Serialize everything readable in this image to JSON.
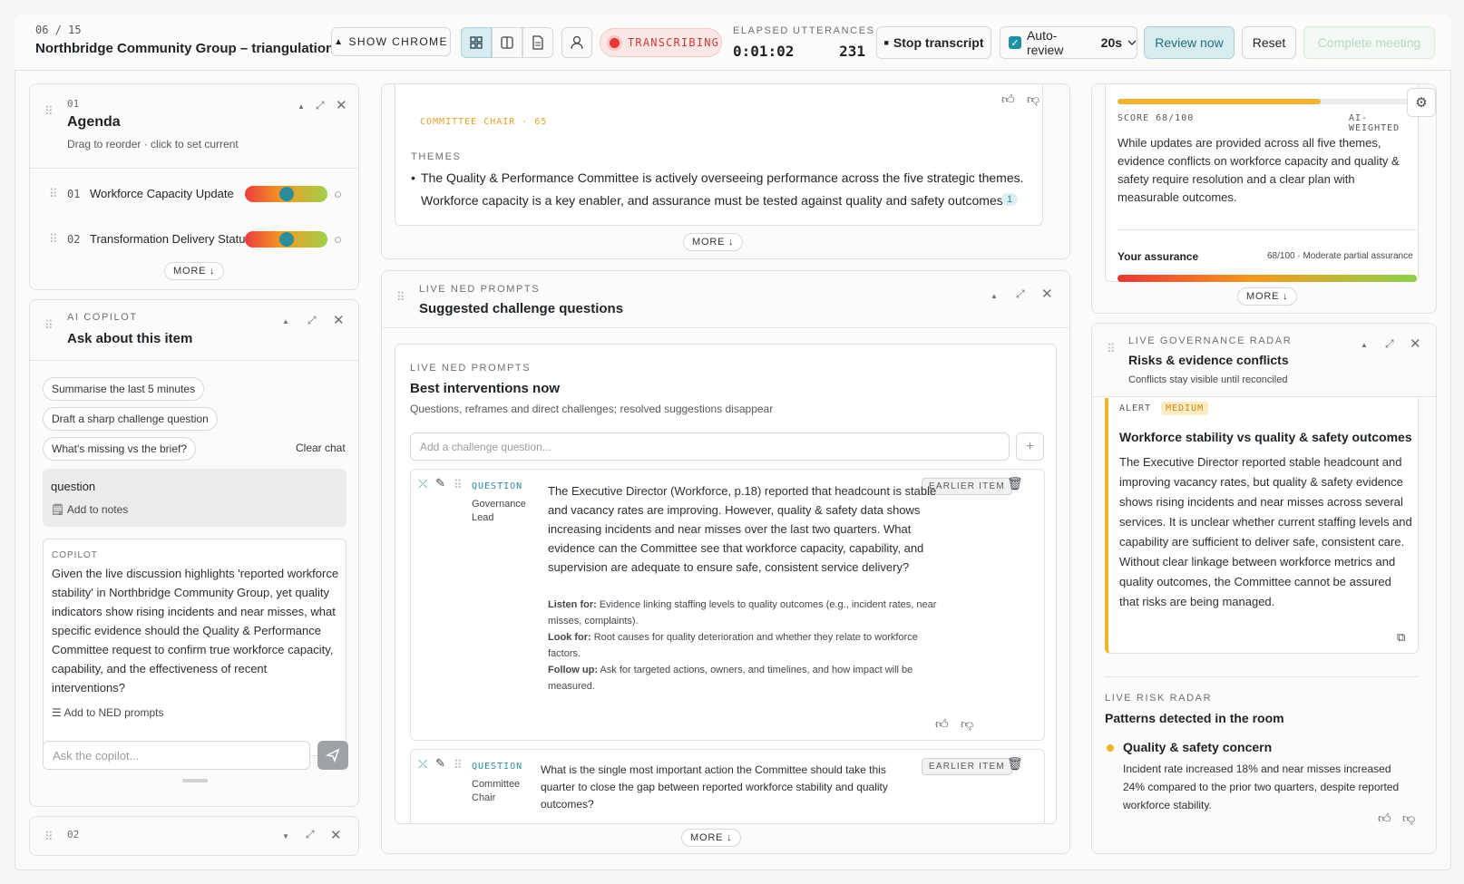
{
  "header": {
    "counter_current": "06",
    "counter_sep": "/",
    "counter_total": "15",
    "title": "Northbridge Community Group – triangulation ...",
    "show_chrome": "SHOW CHROME",
    "status": "TRANSCRIBING",
    "elapsed_label": "ELAPSED",
    "elapsed_value": "0:01:02",
    "utterances_label": "UTTERANCES",
    "utterances_value": "231",
    "stop": "Stop transcript",
    "auto_review": "Auto-review",
    "auto_review_interval": "20s",
    "review_now": "Review now",
    "reset": "Reset",
    "complete": "Complete meeting"
  },
  "agenda": {
    "index": "01",
    "title": "Agenda",
    "subtitle": "Drag to reorder · click to set current",
    "items": [
      {
        "num": "01",
        "label": "Workforce Capacity Update",
        "level": 0.5
      },
      {
        "num": "02",
        "label": "Transformation Delivery Status",
        "level": 0.5
      }
    ],
    "more": "MORE"
  },
  "copilot": {
    "kicker": "AI COPILOT",
    "title": "Ask about this item",
    "chips": [
      "Summarise the last 5 minutes",
      "Draft a sharp challenge question",
      "What's missing vs the brief?"
    ],
    "clear": "Clear chat",
    "question": "question",
    "add_notes": "Add to notes",
    "response_label": "COPILOT",
    "response": "Given the live discussion highlights 'reported workforce stability' in Northbridge Community Group, yet quality indicators show rising incidents and near misses, what specific evidence should the Quality & Performance Committee request to confirm true workforce capacity, capability, and the effectiveness of recent interventions?",
    "add_ned": "Add to NED prompts",
    "input_placeholder": "Ask the copilot..."
  },
  "panel02": {
    "index": "02"
  },
  "themes": {
    "speaker": "COMMITTEE CHAIR · 65",
    "kicker": "THEMES",
    "line1": "The Quality & Performance Committee is actively overseeing performance across the five strategic themes.",
    "line2": "Workforce capacity is a key enabler, and assurance must be tested against quality and safety outcomes.",
    "ref": "1",
    "more": "MORE"
  },
  "challenge": {
    "kicker": "LIVE NED PROMPTS",
    "title": "Suggested challenge questions",
    "inner_kicker": "LIVE NED PROMPTS",
    "inner_title": "Best interventions now",
    "inner_sub": "Questions, reframes and direct challenges; resolved suggestions disappear",
    "input_placeholder": "Add a challenge question...",
    "q1": {
      "type": "QUESTION",
      "role_line1": "Governance",
      "role_line2": "Lead",
      "tag": "EARLIER ITEM",
      "text": "The Executive Director (Workforce, p.18) reported that headcount is stable and vacancy rates are improving. However, quality & safety data shows increasing incidents and near misses over the last two quarters. What evidence can the Committee see that workforce capacity, capability, and supervision are adequate to ensure safe, consistent service delivery?",
      "listen_label": "Listen for:",
      "listen": "Evidence linking staffing levels to quality outcomes (e.g., incident rates, near misses, complaints).",
      "look_label": "Look for:",
      "look": "Root causes for quality deterioration and whether they relate to workforce factors.",
      "follow_label": "Follow up:",
      "follow": "Ask for targeted actions, owners, and timelines, and how impact will be measured."
    },
    "q2": {
      "type": "QUESTION",
      "role_line1": "Committee",
      "role_line2": "Chair",
      "tag": "EARLIER ITEM",
      "text": "What is the single most important action the Committee should take this quarter to close the gap between reported workforce stability and quality outcomes?"
    },
    "more": "MORE"
  },
  "score": {
    "label": "SCORE 68/100",
    "value": 68,
    "weighting": "AI-WEIGHTED",
    "summary": "While updates are provided across all five themes, evidence conflicts on workforce capacity and quality & safety require resolution and a clear plan with measurable outcomes.",
    "assurance_label": "Your assurance",
    "assurance_value": "68/100 · Moderate partial assurance",
    "more": "MORE",
    "bar_color": "#f2b233"
  },
  "radar": {
    "kicker": "LIVE GOVERNANCE RADAR",
    "title": "Risks & evidence conflicts",
    "subtitle": "Conflicts stay visible until reconciled",
    "alert_label": "ALERT",
    "alert_level": "MEDIUM",
    "alert_title": "Workforce stability vs quality & safety outcomes",
    "alert_text": "The Executive Director reported stable headcount and improving vacancy rates, but quality & safety evidence shows rising incidents and near misses across several services. It is unclear whether current staffing levels and capability are sufficient to deliver safe, consistent care. Without clear linkage between workforce metrics and quality outcomes, the Committee cannot be assured that risks are being managed.",
    "risk_kicker": "LIVE RISK RADAR",
    "risk_title": "Patterns detected in the room",
    "pattern_title": "Quality & safety concern",
    "pattern_text": "Incident rate increased 18% and near misses increased 24% compared to the prior two quarters, despite reported workforce stability.",
    "accent": "#f0b429"
  }
}
